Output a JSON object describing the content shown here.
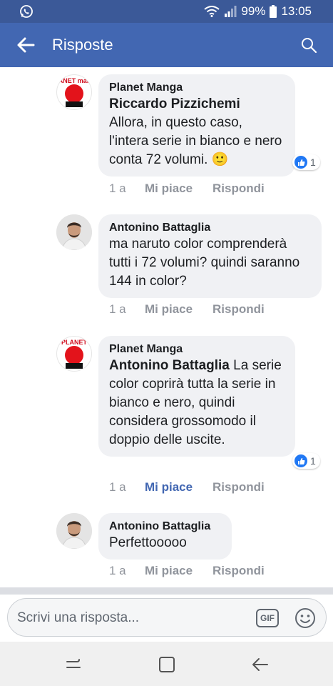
{
  "status_bar": {
    "battery": "99%",
    "time": "13:05"
  },
  "app_bar": {
    "title": "Risposte"
  },
  "comments": [
    {
      "avatar_text": "PLANET manga",
      "author": "Planet Manga",
      "mention": "Riccardo Pizzichemi",
      "text": "Allora, in questo caso, l'intera serie in bianco e nero conta 72 volumi. 🙂",
      "reactions": "1",
      "time": "1 a",
      "like": "Mi piace",
      "reply": "Rispondi"
    },
    {
      "author": "Antonino Battaglia",
      "text": "ma naruto color comprenderà tutti i 72 volumi? quindi saranno 144 in color?",
      "time": "1 a",
      "like": "Mi piace",
      "reply": "Rispondi"
    },
    {
      "avatar_text": "PLANET manga",
      "author": "Planet Manga",
      "mention": "Antonino Battaglia",
      "text": "La serie color coprirà tutta la serie in bianco e nero, quindi considera grossomodo il doppio delle uscite.",
      "reactions": "1",
      "time": "1 a",
      "like": "Mi piace",
      "reply": "Rispondi"
    },
    {
      "author": "Antonino Battaglia",
      "text": "Perfettooooo",
      "time": "1 a",
      "like": "Mi piace",
      "reply": "Rispondi"
    }
  ],
  "composer": {
    "placeholder": "Scrivi una risposta...",
    "gif_label": "GIF"
  },
  "colors": {
    "facebook_blue": "#4267b2",
    "status_blue": "#3b5998",
    "bubble_bg": "#f0f1f4",
    "meta_gray": "#90949c",
    "like_blue": "#2078f4"
  }
}
